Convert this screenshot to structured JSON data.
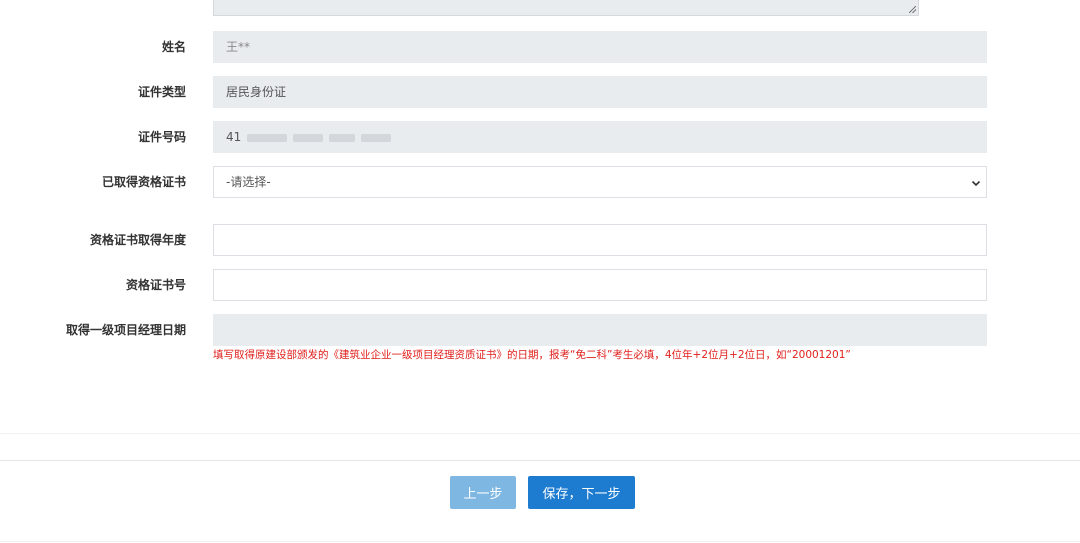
{
  "form": {
    "name": {
      "label": "姓名",
      "value": "王**"
    },
    "id_type": {
      "label": "证件类型",
      "value": "居民身份证"
    },
    "id_number": {
      "label": "证件号码",
      "value": "41"
    },
    "certificate": {
      "label": "已取得资格证书",
      "selected": "-请选择-"
    },
    "cert_year": {
      "label": "资格证书取得年度",
      "value": ""
    },
    "cert_number": {
      "label": "资格证书号",
      "value": ""
    },
    "pm_date": {
      "label": "取得一级项目经理日期",
      "value": "",
      "hint": "填写取得原建设部颁发的《建筑业企业一级项目经理资质证书》的日期，报考“免二科”考生必填，4位年+2位月+2位日，如“20001201”"
    }
  },
  "buttons": {
    "prev": "上一步",
    "next": "保存，下一步"
  },
  "colors": {
    "readonly_bg": "#e9ecef",
    "hint_red": "#e0201c",
    "primary": "#1d7bd0",
    "primary_disabled": "#7fb7e3"
  }
}
